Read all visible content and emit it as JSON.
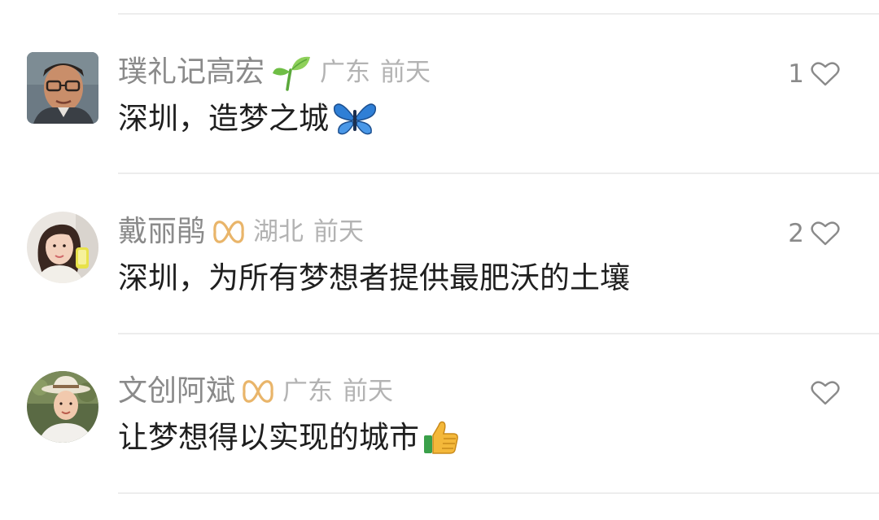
{
  "comments": [
    {
      "username": "璞礼记高宏",
      "badge_icon": "sprout-icon",
      "location": "广东",
      "time": "前天",
      "text": "深圳，造梦之城",
      "text_emoji": "butterfly-emoji",
      "like_count": "1"
    },
    {
      "username": "戴丽鹃",
      "badge_icon": "infinity-badge-icon",
      "location": "湖北",
      "time": "前天",
      "text": "深圳，为所有梦想者提供最肥沃的土壤",
      "like_count": "2"
    },
    {
      "username": "文创阿斌",
      "badge_icon": "infinity-badge-icon",
      "location": "广东",
      "time": "前天",
      "text": "让梦想得以实现的城市",
      "text_emoji": "thumbs-up-emoji",
      "like_count": ""
    }
  ],
  "colors": {
    "username": "#8a8a8a",
    "meta": "#b3b3b3",
    "text": "#1f1f1f",
    "divider": "#ededed",
    "badge": "#e9b56a"
  }
}
